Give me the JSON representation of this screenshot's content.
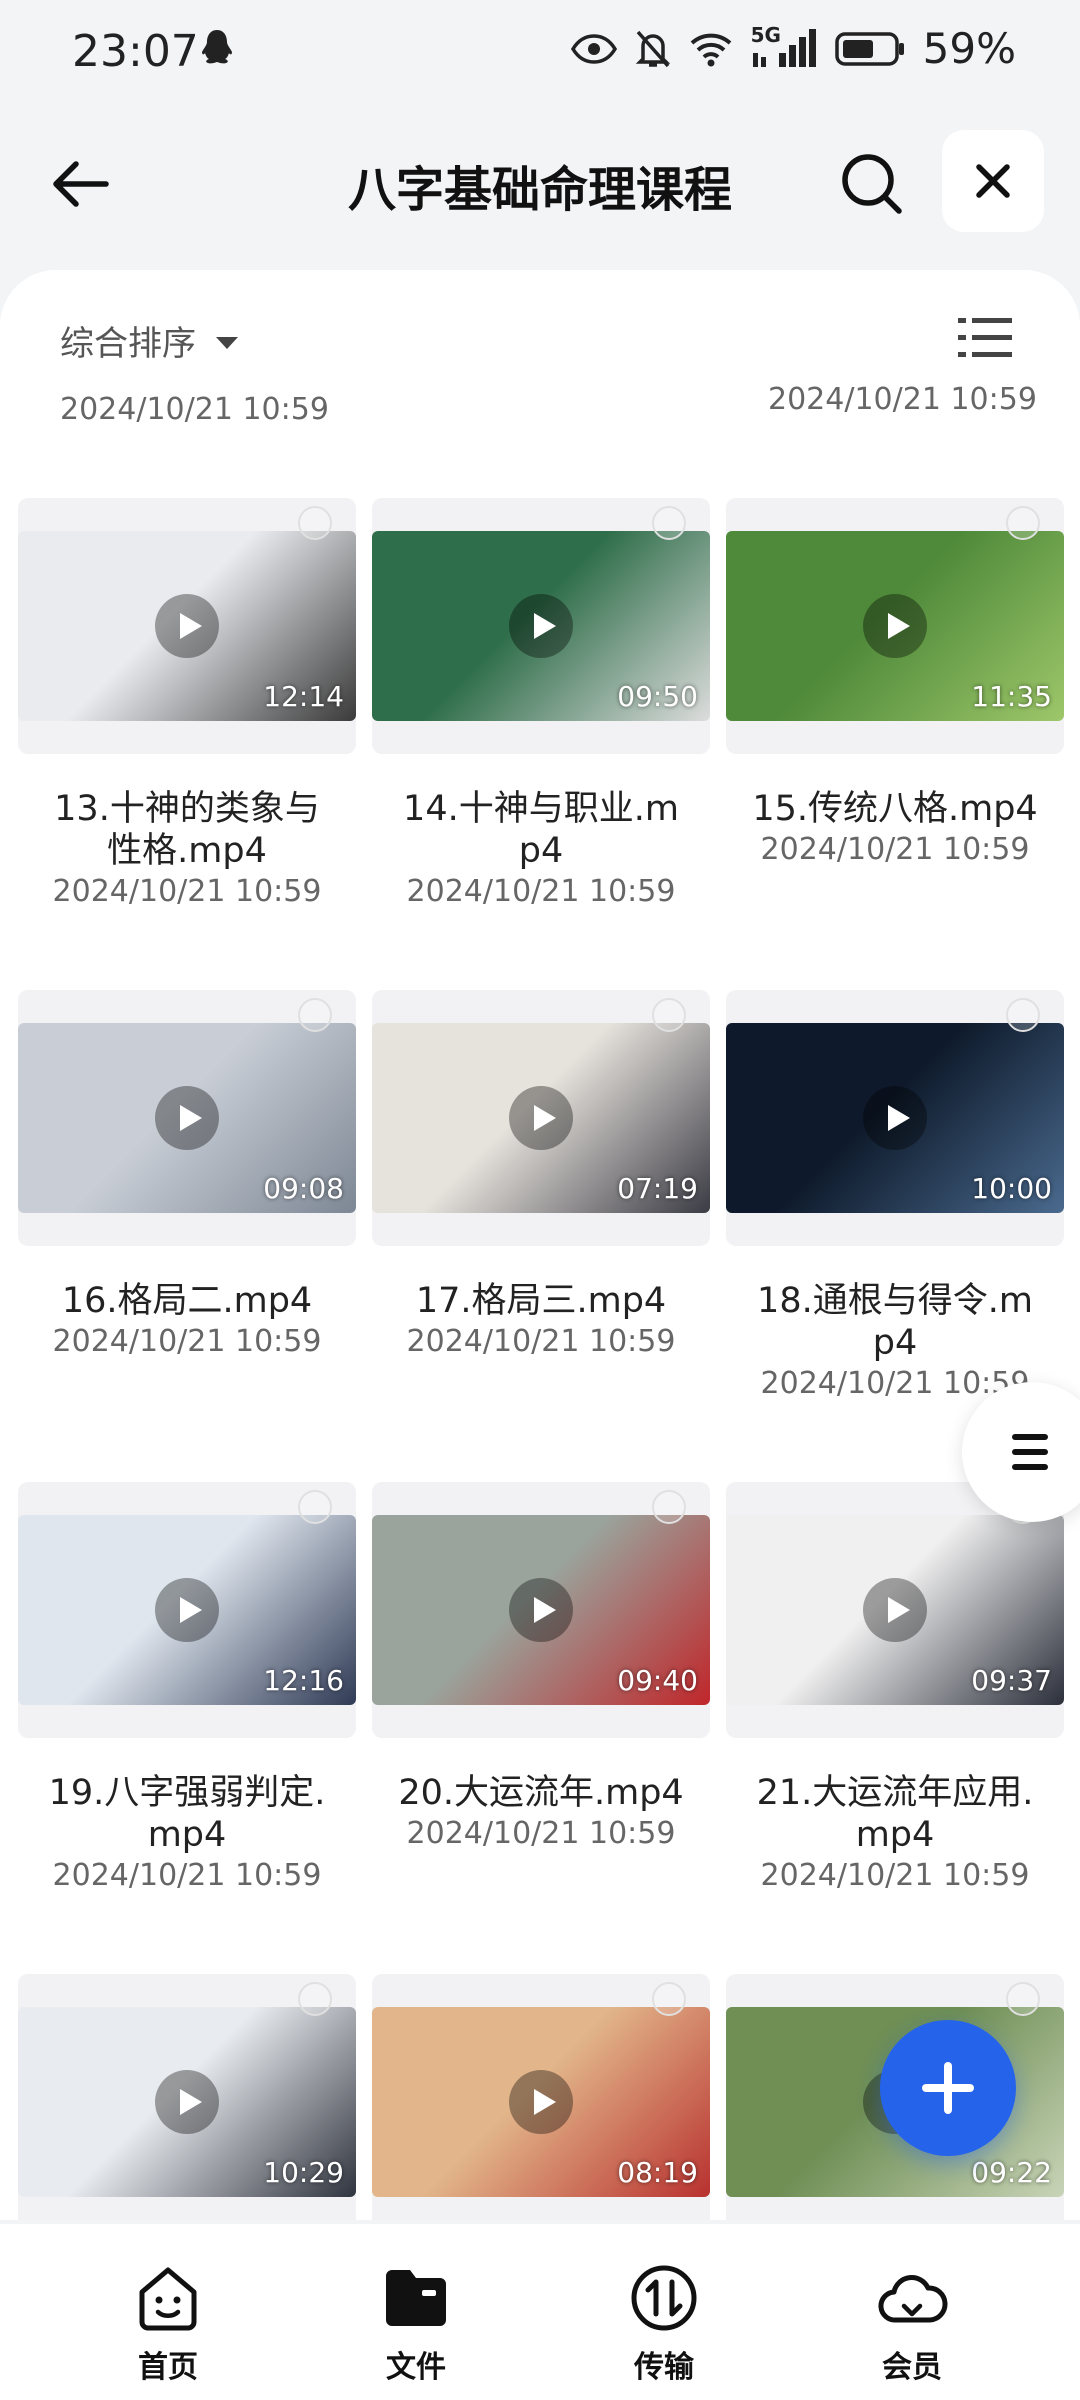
{
  "status": {
    "time": "23:07",
    "network": "5G",
    "battery": "59%"
  },
  "header": {
    "title": "八字基础命理课程"
  },
  "toolbar": {
    "sort_label": "综合排序"
  },
  "previous_row_dates": [
    "2024/10/21 10:59",
    "2024/10/21 10:59"
  ],
  "files": [
    {
      "name": "13.十神的类象与性格.mp4",
      "name_lines": [
        "13.十神的类象与",
        "性格.mp4"
      ],
      "date": "2024/10/21 10:59",
      "duration": "12:14",
      "colors": [
        "#e9ebef",
        "#3a3a3a"
      ]
    },
    {
      "name": "14.十神与职业.mp4",
      "name_lines": [
        "14.十神与职业.m",
        "p4"
      ],
      "date": "2024/10/21 10:59",
      "duration": "09:50",
      "colors": [
        "#2f6e4a",
        "#dcdcdc"
      ]
    },
    {
      "name": "15.传统八格.mp4",
      "name_lines": [
        "15.传统八格.mp4"
      ],
      "date": "2024/10/21 10:59",
      "duration": "11:35",
      "colors": [
        "#4f8a3a",
        "#9ec76a"
      ]
    },
    {
      "name": "16.格局二.mp4",
      "name_lines": [
        "16.格局二.mp4"
      ],
      "date": "2024/10/21 10:59",
      "duration": "09:08",
      "colors": [
        "#c9ced6",
        "#7d8794"
      ]
    },
    {
      "name": "17.格局三.mp4",
      "name_lines": [
        "17.格局三.mp4"
      ],
      "date": "2024/10/21 10:59",
      "duration": "07:19",
      "colors": [
        "#e6e2dc",
        "#3b3b44"
      ]
    },
    {
      "name": "18.通根与得令.mp4",
      "name_lines": [
        "18.通根与得令.m",
        "p4"
      ],
      "date": "2024/10/21 10:59",
      "duration": "10:00",
      "colors": [
        "#0e1a2b",
        "#4a6a8e"
      ]
    },
    {
      "name": "19.八字强弱判定.mp4",
      "name_lines": [
        "19.八字强弱判定.",
        "mp4"
      ],
      "date": "2024/10/21 10:59",
      "duration": "12:16",
      "colors": [
        "#dfe6ee",
        "#2f3a55"
      ]
    },
    {
      "name": "20.大运流年.mp4",
      "name_lines": [
        "20.大运流年.mp4"
      ],
      "date": "2024/10/21 10:59",
      "duration": "09:40",
      "colors": [
        "#9aa39c",
        "#c0262a"
      ]
    },
    {
      "name": "21.大运流年应用.mp4",
      "name_lines": [
        "21.大运流年应用.",
        "mp4"
      ],
      "date": "2024/10/21 10:59",
      "duration": "09:37",
      "colors": [
        "#f0f0f0",
        "#2b2f3a"
      ]
    },
    {
      "name": "",
      "name_lines": [],
      "date": "",
      "duration": "10:29",
      "colors": [
        "#e8ebef",
        "#30343e"
      ]
    },
    {
      "name": "",
      "name_lines": [],
      "date": "",
      "duration": "08:19",
      "colors": [
        "#e2b68a",
        "#b8312f"
      ]
    },
    {
      "name": "",
      "name_lines": [],
      "date": "",
      "duration": "09:22",
      "colors": [
        "#6f8f55",
        "#c9d4b8"
      ]
    }
  ],
  "bottom_nav": [
    {
      "label": "首页",
      "icon": "home-face-icon"
    },
    {
      "label": "文件",
      "icon": "folder-icon"
    },
    {
      "label": "传输",
      "icon": "transfer-icon"
    },
    {
      "label": "会员",
      "icon": "cloud-icon"
    }
  ],
  "accent_color": "#2563eb"
}
